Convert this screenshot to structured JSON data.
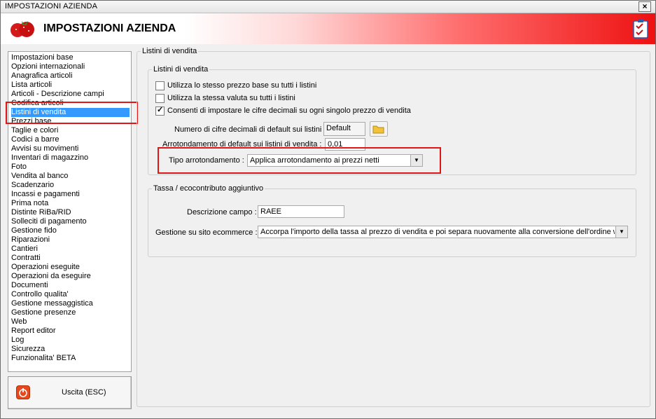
{
  "window": {
    "title": "IMPOSTAZIONI AZIENDA",
    "banner_title": "IMPOSTAZIONI AZIENDA"
  },
  "sidebar": {
    "items": [
      "Impostazioni base",
      "Opzioni internazionali",
      "Anagrafica articoli",
      "Lista articoli",
      "Articoli - Descrizione campi",
      "Codifica articoli",
      "Listini di vendita",
      "Prezzi base",
      "Taglie e colori",
      "Codici a barre",
      "Avvisi su movimenti",
      "Inventari di magazzino",
      "Foto",
      "Vendita al banco",
      "Scadenzario",
      "Incassi e pagamenti",
      "Prima nota",
      "Distinte RiBa/RID",
      "Solleciti di pagamento",
      "Gestione fido",
      "Riparazioni",
      "Cantieri",
      "Contratti",
      "Operazioni eseguite",
      "Operazioni da eseguire",
      "Documenti",
      "Controllo qualita'",
      "Gestione messaggistica",
      "Gestione presenze",
      "Web",
      "Report editor",
      "Log",
      "Sicurezza",
      "Funzionalita' BETA"
    ],
    "selected": "Listini di vendita",
    "exit_label": "Uscita (ESC)"
  },
  "main": {
    "outer_group": "Listini di vendita",
    "listini": {
      "legend": "Listini di vendita",
      "chk1": "Utilizza lo stesso prezzo base su tutti i listini",
      "chk2": "Utilizza la stessa valuta su tutti i listini",
      "chk3": "Consenti di impostare le cifre decimali su ogni singolo prezzo di vendita",
      "decimali_label": "Numero di cifre decimali di default sui listini :",
      "decimali_value": "Default",
      "arrot_label": "Arrotondamento di default sui listini di vendita :",
      "arrot_value": "0,01",
      "tipo_label": "Tipo arrotondamento :",
      "tipo_value": "Applica arrotondamento ai prezzi netti"
    },
    "tassa": {
      "legend": "Tassa / ecocontributo aggiuntivo",
      "desc_label": "Descrizione campo :",
      "desc_value": "RAEE",
      "ecom_label": "Gestione su sito ecommerce :",
      "ecom_value": "Accorpa l'importo della tassa al prezzo di vendita e poi separa nuovamente alla conversione dell'ordine web"
    }
  },
  "checks": {
    "chk1": false,
    "chk2": false,
    "chk3": true
  },
  "colors": {
    "selection": "#3399ff",
    "highlight": "#e01515",
    "banner_red": "#ee1111"
  }
}
